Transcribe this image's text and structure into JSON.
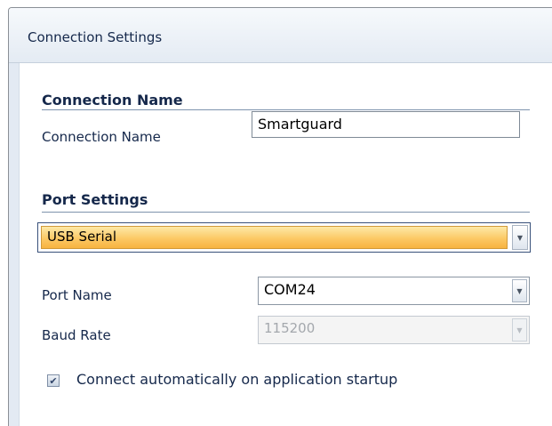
{
  "header": {
    "title": "Connection Settings"
  },
  "connection_name_section": {
    "title": "Connection Name",
    "field_label": "Connection Name",
    "field_value": "Smartguard"
  },
  "port_settings_section": {
    "title": "Port Settings",
    "port_type_value": "USB Serial",
    "port_name_label": "Port Name",
    "port_name_value": "COM24",
    "baud_rate_label": "Baud Rate",
    "baud_rate_value": "115200"
  },
  "auto_connect": {
    "checked": true,
    "label": "Connect automatically on application startup"
  },
  "icons": {
    "dropdown": "chevron-down-icon",
    "checkbox": "checkmark-icon"
  }
}
